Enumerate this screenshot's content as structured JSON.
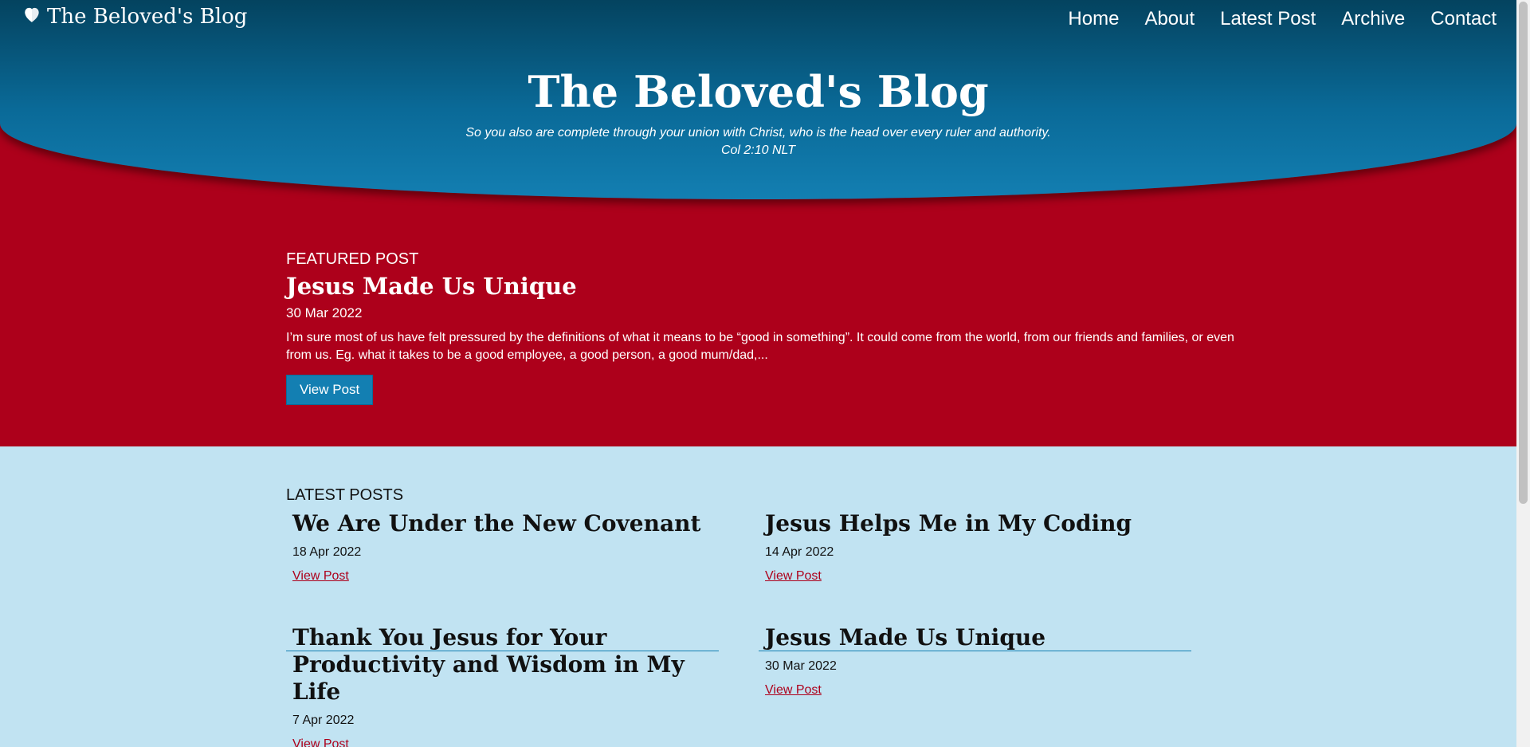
{
  "site": {
    "brand": "The Beloved's Blog",
    "brand_icon": "heart-icon"
  },
  "nav": {
    "items": [
      {
        "label": "Home"
      },
      {
        "label": "About"
      },
      {
        "label": "Latest Post"
      },
      {
        "label": "Archive"
      },
      {
        "label": "Contact"
      }
    ]
  },
  "hero": {
    "title": "The Beloved's Blog",
    "verse": "So you also are complete through your union with Christ, who is the head over every ruler and authority.",
    "reference": "Col 2:10 NLT"
  },
  "featured": {
    "label": "FEATURED POST",
    "title": "Jesus Made Us Unique",
    "date": "30 Mar 2022",
    "excerpt": "I’m sure most of us have felt pressured by the definitions of what it means to be “good in something”. It could come from the world, from our friends and families, or even from us. Eg. what it takes to be a good employee, a good person, a good mum/dad,...",
    "button_label": "View Post"
  },
  "latest": {
    "label": "LATEST POSTS",
    "posts": [
      {
        "title": "We Are Under the New Covenant",
        "date": "18 Apr 2022",
        "link": "View Post"
      },
      {
        "title": "Jesus Helps Me in My Coding",
        "date": "14 Apr 2022",
        "link": "View Post"
      },
      {
        "title": "Thank You Jesus for Your Productivity and Wisdom in My Life",
        "date": "7 Apr 2022",
        "link": "View Post"
      },
      {
        "title": "Jesus Made Us Unique",
        "date": "30 Mar 2022",
        "link": "View Post"
      }
    ]
  },
  "colors": {
    "header_dark": "#04435f",
    "header_light": "#137fb2",
    "featured_bg": "#ad001b",
    "latest_bg": "#c1e3f2",
    "link": "#ad001b"
  }
}
